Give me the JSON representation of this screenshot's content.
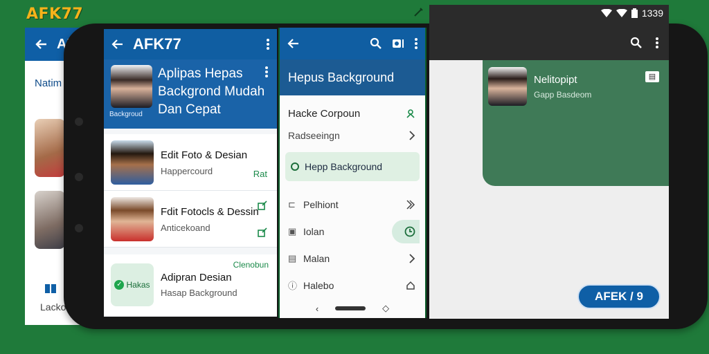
{
  "brand": {
    "name": "AFK77"
  },
  "back_card": {
    "bar_title": "AF",
    "label": "Natim",
    "footer_label": "Lacko"
  },
  "screen1": {
    "title": "AFK77",
    "hero": {
      "text": "Aplipas Hepas Backgrond Mudah Dan Cepat",
      "caption": "Backgroud"
    },
    "items": [
      {
        "title": "Edit Foto & Desian",
        "subtitle": "Happercourd",
        "action": "Rat"
      },
      {
        "title": "Fdit Fotocls & Dessin",
        "subtitle": "Anticekoand",
        "action": ""
      }
    ],
    "promo": {
      "badge": "Hakas",
      "title": "Adipran Desian",
      "subtitle": "Hasap Background",
      "tag": "Clenobun"
    }
  },
  "screen2": {
    "header": "Hepus Background",
    "rows": [
      {
        "label": "Hacke Corpoun"
      },
      {
        "label": "Radseeingn"
      }
    ],
    "selected": "Hepp Background",
    "list": [
      {
        "label": "Pelhiont"
      },
      {
        "label": "Iolan"
      },
      {
        "label": "Malan"
      },
      {
        "label": "Halebo"
      }
    ]
  },
  "screen3": {
    "time": "1339",
    "card": {
      "title": "Nelitopipt",
      "subtitle": "Gapp Basdeom"
    },
    "fab": "AFEK / 9"
  },
  "colors": {
    "green_bg": "#1f7a3a",
    "blue_bar": "#105ea2",
    "accent_green": "#3f7a57"
  }
}
